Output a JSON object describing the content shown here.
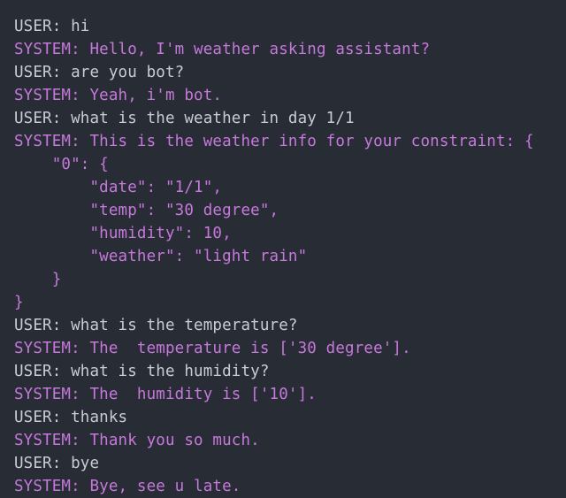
{
  "colors": {
    "background": "#282c34",
    "user_text": "#c8ccd4",
    "system_text": "#c678dd"
  },
  "lines": [
    {
      "speaker": "user",
      "text": "USER: hi"
    },
    {
      "speaker": "system",
      "text": "SYSTEM: Hello, I'm weather asking assistant?"
    },
    {
      "speaker": "user",
      "text": "USER: are you bot?"
    },
    {
      "speaker": "system",
      "text": "SYSTEM: Yeah, i'm bot."
    },
    {
      "speaker": "user",
      "text": "USER: what is the weather in day 1/1"
    },
    {
      "speaker": "system",
      "text": "SYSTEM: This is the weather info for your constraint: {"
    },
    {
      "speaker": "system",
      "text": "    \"0\": {"
    },
    {
      "speaker": "system",
      "text": "        \"date\": \"1/1\","
    },
    {
      "speaker": "system",
      "text": "        \"temp\": \"30 degree\","
    },
    {
      "speaker": "system",
      "text": "        \"humidity\": 10,"
    },
    {
      "speaker": "system",
      "text": "        \"weather\": \"light rain\""
    },
    {
      "speaker": "system",
      "text": "    }"
    },
    {
      "speaker": "system",
      "text": "}"
    },
    {
      "speaker": "user",
      "text": "USER: what is the temperature?"
    },
    {
      "speaker": "system",
      "text": "SYSTEM: The  temperature is ['30 degree']."
    },
    {
      "speaker": "user",
      "text": "USER: what is the humidity?"
    },
    {
      "speaker": "system",
      "text": "SYSTEM: The  humidity is ['10']."
    },
    {
      "speaker": "user",
      "text": "USER: thanks"
    },
    {
      "speaker": "system",
      "text": "SYSTEM: Thank you so much."
    },
    {
      "speaker": "user",
      "text": "USER: bye"
    },
    {
      "speaker": "system",
      "text": "SYSTEM: Bye, see u late."
    }
  ]
}
